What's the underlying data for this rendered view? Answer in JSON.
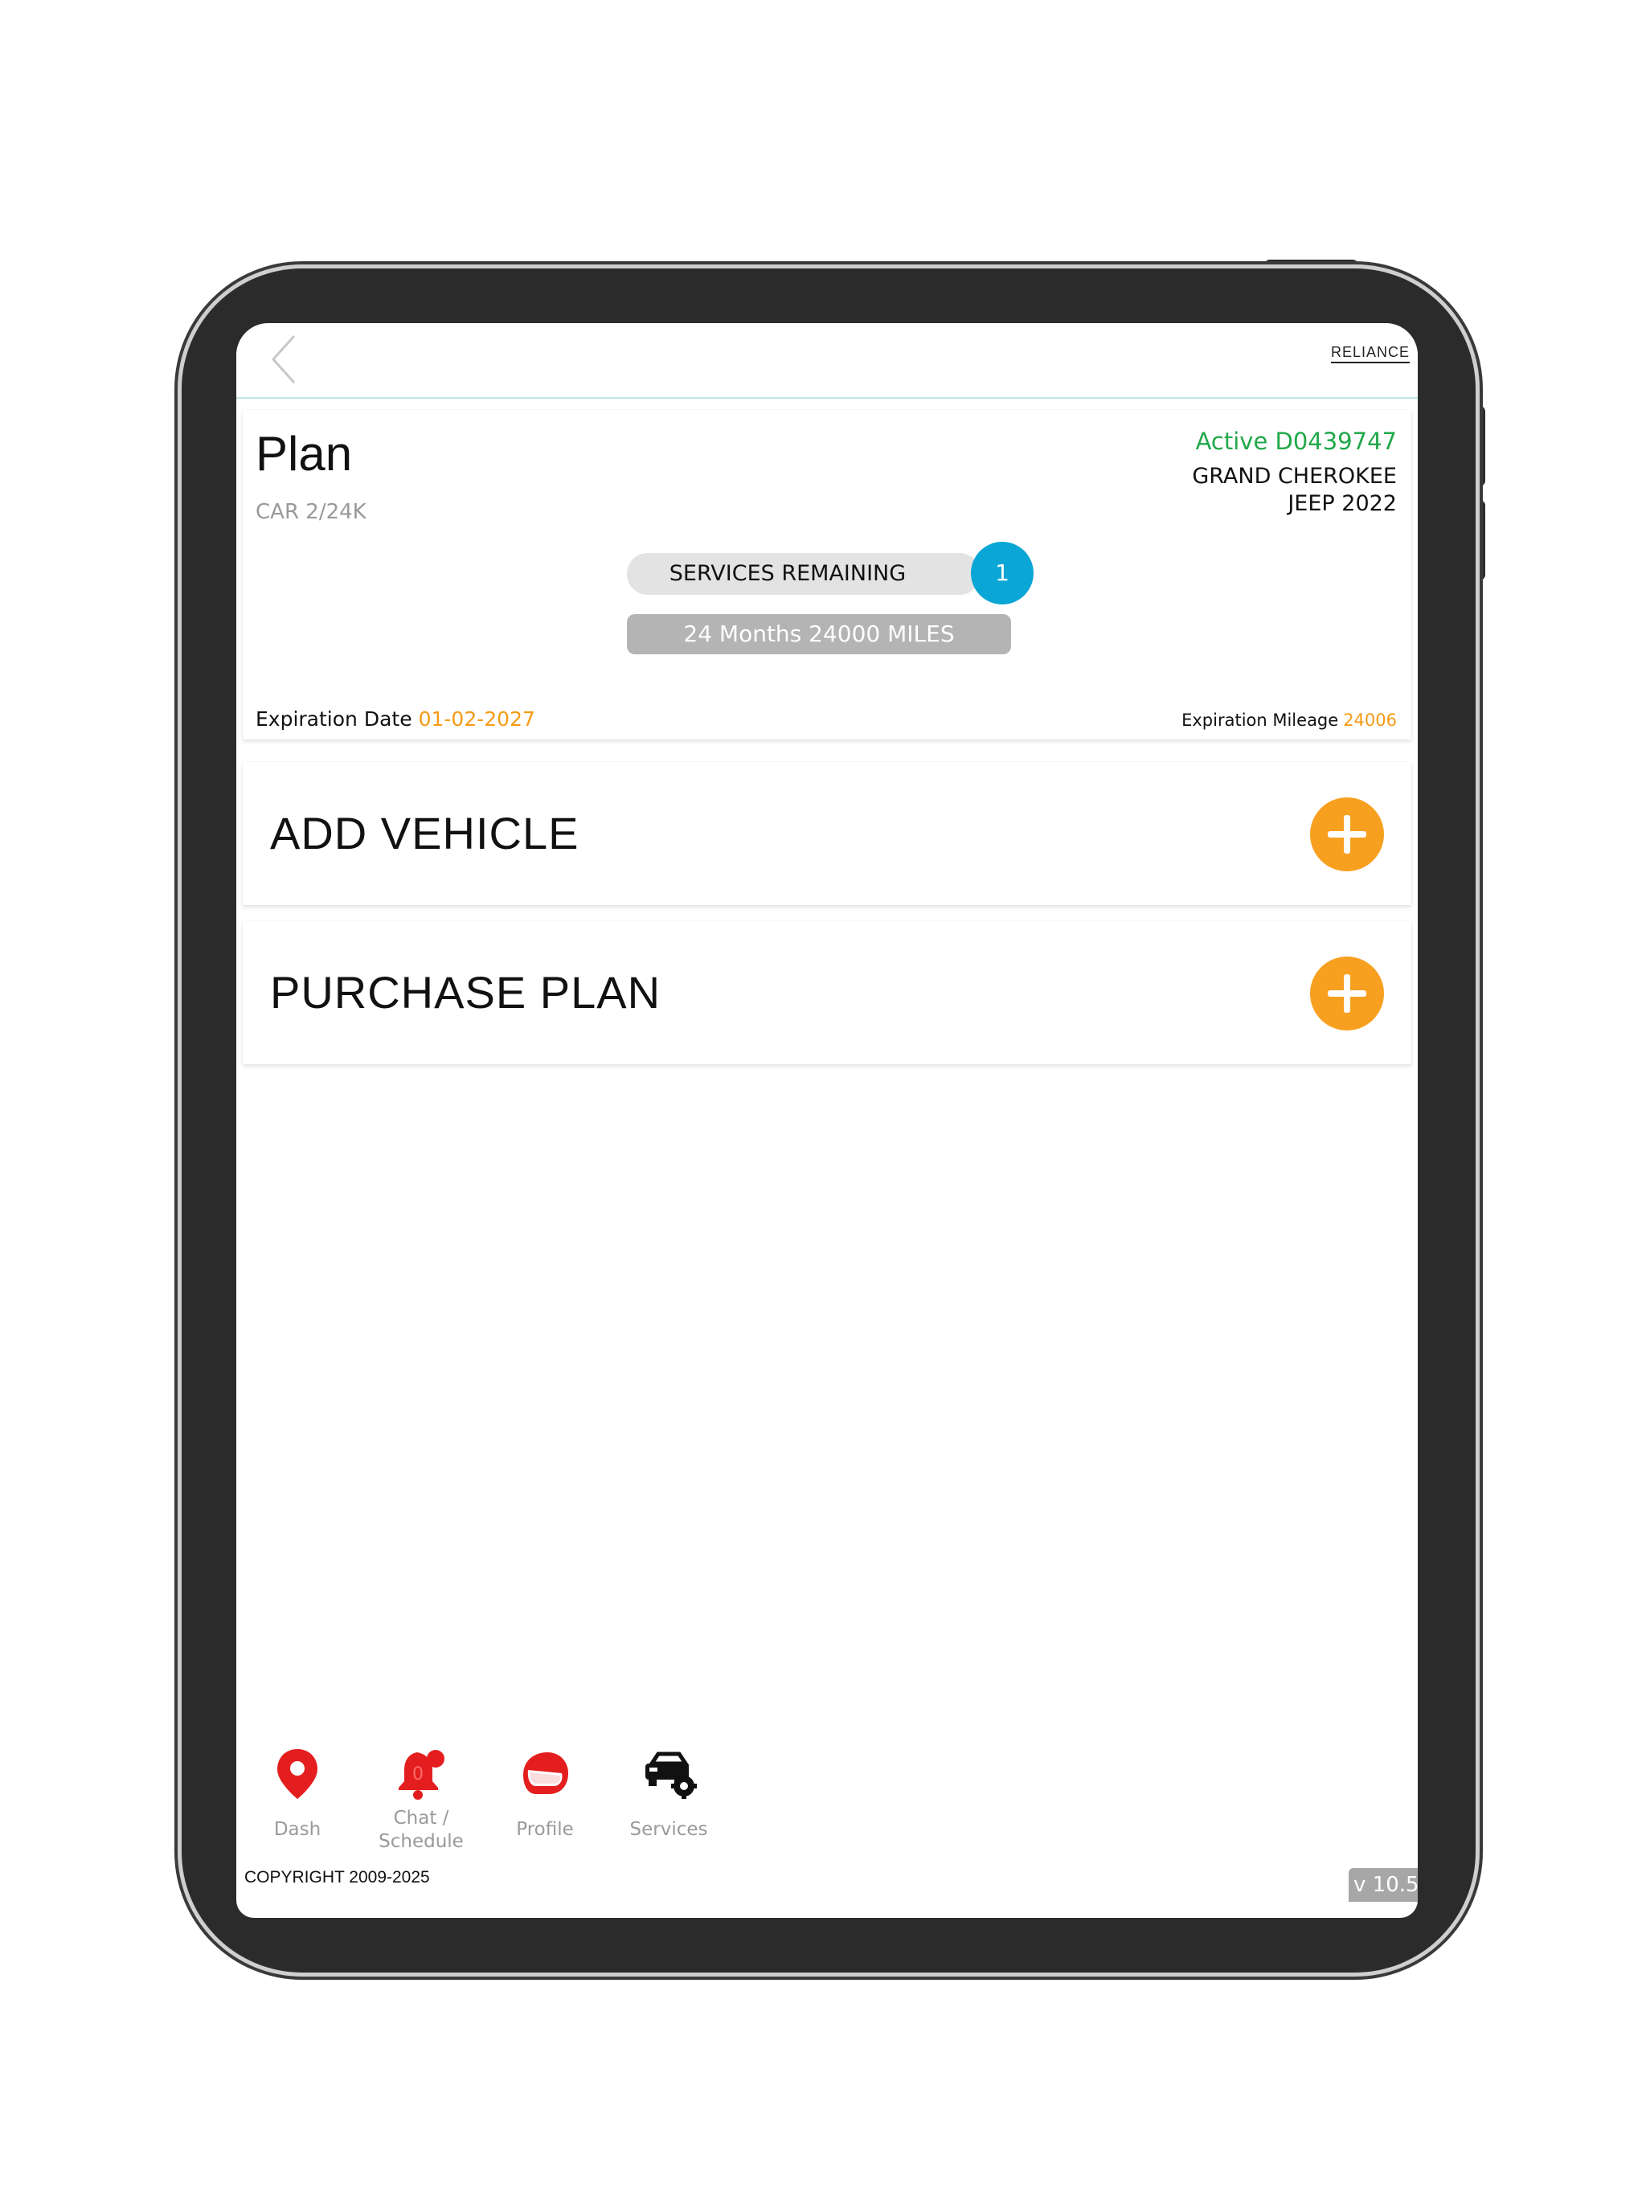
{
  "header": {
    "brand": "RELIANCE"
  },
  "plan": {
    "title": "Plan",
    "subtitle": "CAR 2/24K",
    "status": "Active D0439747",
    "vehicle_model": "GRAND CHEROKEE",
    "vehicle_make_year": "JEEP 2022",
    "services_label": "SERVICES REMAINING",
    "services_count": "1",
    "term": "24 Months 24000 MILES",
    "expiration_date_label": "Expiration Date",
    "expiration_date": "01-02-2027",
    "expiration_mileage_label": "Expiration Mileage",
    "expiration_mileage": "24006"
  },
  "actions": {
    "add_vehicle": "ADD VEHICLE",
    "purchase_plan": "PURCHASE PLAN"
  },
  "nav": {
    "dash": "Dash",
    "chat_line1": "Chat /",
    "chat_line2": "Schedule",
    "chat_badge": "0",
    "profile": "Profile",
    "services": "Services"
  },
  "footer": {
    "copyright": "COPYRIGHT 2009-2025",
    "version": "v 10.5"
  },
  "colors": {
    "accent_orange": "#f7a020",
    "status_green": "#21a84a",
    "badge_blue": "#0aa6d6",
    "nav_red": "#e41e1e"
  }
}
